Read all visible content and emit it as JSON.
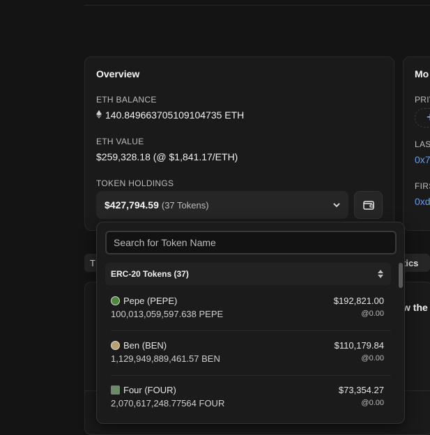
{
  "overview": {
    "title": "Overview",
    "eth_balance_label": "ETH BALANCE",
    "eth_balance_value": "140.849663705109104735 ETH",
    "eth_value_label": "ETH VALUE",
    "eth_value_value": "$259,328.18 (@ $1,841.17/ETH)",
    "token_holdings_label": "TOKEN HOLDINGS",
    "holdings_amount": "$427,794.59",
    "holdings_count": "(37 Tokens)"
  },
  "right_card": {
    "title": "Mo",
    "label_1": "PRIV",
    "label_2": "LAS",
    "link_2": "0x7",
    "label_3": "FIRS",
    "link_3": "0xd"
  },
  "tabs": {
    "left_partial": "T",
    "right_partial": "tics"
  },
  "lower": {
    "text": "w the"
  },
  "dropdown": {
    "search_placeholder": "Search for Token Name",
    "group_label": "ERC-20 Tokens (37)",
    "tokens": [
      {
        "name": "Pepe (PEPE)",
        "amount": "100,013,059,597.638 PEPE",
        "value": "$192,821.00",
        "price": "@0.00",
        "icon_color": "#4a8a3a"
      },
      {
        "name": "Ben (BEN)",
        "amount": "1,129,949,889,461.57 BEN",
        "value": "$110,179.84",
        "price": "@0.00",
        "icon_color": "#b8a070"
      },
      {
        "name": "Four (FOUR)",
        "amount": "2,070,617,248.77564 FOUR",
        "value": "$73,354.27",
        "price": "@0.00",
        "icon_color": "#6a8a6a"
      }
    ]
  },
  "colors": {
    "background": "#141414",
    "card": "#1a1a1a",
    "link": "#5aa0ff"
  }
}
